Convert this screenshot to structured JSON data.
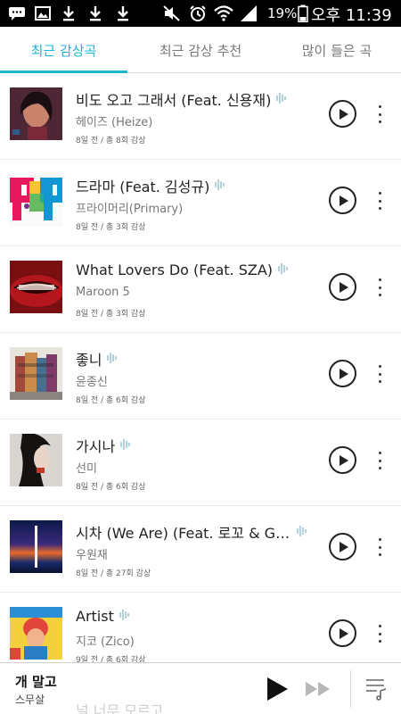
{
  "status_bar": {
    "battery_percent": "19%",
    "time": "오후 11:39",
    "icons": [
      "chat-icon",
      "image-icon",
      "download-icon",
      "download-icon",
      "download-icon",
      "mute-icon",
      "alarm-icon",
      "wifi-icon",
      "signal-icon",
      "battery-icon"
    ]
  },
  "tabs": [
    {
      "label": "최근 감상곡",
      "active": true
    },
    {
      "label": "최근 감상 추천",
      "active": false
    },
    {
      "label": "많이 들은 곡",
      "active": false
    }
  ],
  "songs": [
    {
      "title": "비도 오고 그래서 (Feat. 신용재)",
      "artist": "헤이즈 (Heize)",
      "meta": "8일 전 / 총 8회 감상"
    },
    {
      "title": "드라마 (Feat. 김성규)",
      "artist": "프라이머리(Primary)",
      "meta": "8일 전 / 총 3회 감상"
    },
    {
      "title": "What Lovers Do (Feat. SZA)",
      "artist": "Maroon 5",
      "meta": "8일 전 / 총 3회 감상"
    },
    {
      "title": "좋니",
      "artist": "윤종신",
      "meta": "8일 전 / 총 6회 감상"
    },
    {
      "title": "가시나",
      "artist": "선미",
      "meta": "8일 전 / 총 6회 감상"
    },
    {
      "title": "시차 (We Are) (Feat. 로꼬 & GR...",
      "artist": "우원재",
      "meta": "8일 전 / 총 27회 감상"
    },
    {
      "title": "Artist",
      "artist": "지코 (Zico)",
      "meta": "9일 전 / 총 6회 감상"
    }
  ],
  "peek_song": {
    "title": "널 너무 모르고"
  },
  "player": {
    "title": "개 말고",
    "artist": "스무살"
  }
}
